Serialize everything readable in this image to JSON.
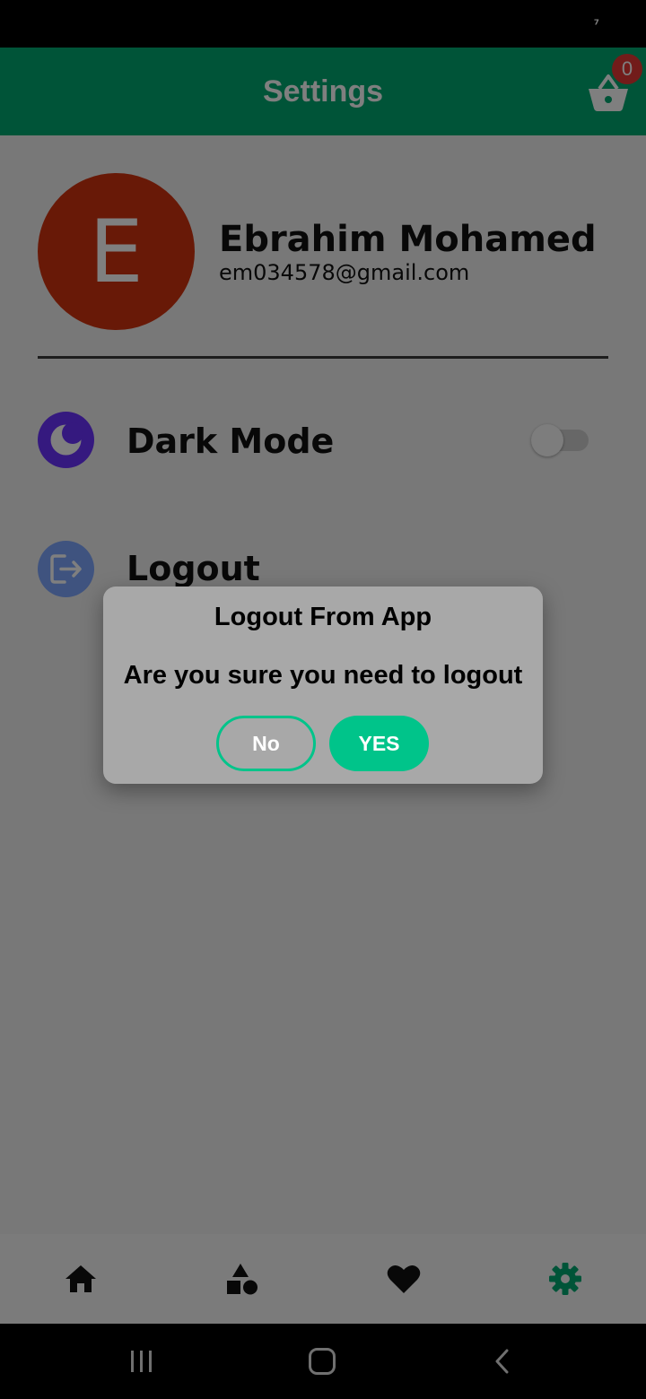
{
  "status_bar": {
    "glyph": "⁷"
  },
  "app_bar": {
    "title": "Settings",
    "cart_icon": "shopping-basket-icon",
    "cart_badge": "0"
  },
  "profile": {
    "initial": "E",
    "name": "Ebrahim Mohamed",
    "email": "em034578@gmail.com",
    "avatar_color": "#d0320f"
  },
  "settings": {
    "dark_mode": {
      "label": "Dark Mode",
      "icon": "moon-icon",
      "enabled": false
    },
    "logout": {
      "label": "Logout",
      "icon": "logout-icon"
    }
  },
  "dialog": {
    "title": "Logout From App",
    "message": "Are you sure you need to logout",
    "no_label": "No",
    "yes_label": "YES"
  },
  "bottom_nav": {
    "items": [
      {
        "icon": "home-icon",
        "active": false
      },
      {
        "icon": "categories-icon",
        "active": false
      },
      {
        "icon": "heart-icon",
        "active": false
      },
      {
        "icon": "gear-icon",
        "active": true
      }
    ]
  },
  "colors": {
    "primary": "#00a870",
    "accent": "#00c48a",
    "badge": "#e53935",
    "dark_mode_icon_bg": "#6b32ff",
    "logout_icon_bg": "#7ea7ff"
  }
}
